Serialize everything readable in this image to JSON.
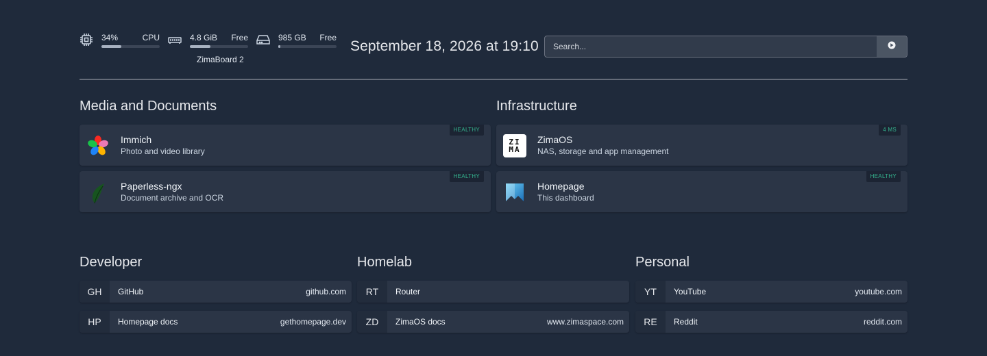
{
  "widgets": {
    "cpu": {
      "value": "34%",
      "label": "CPU",
      "percent": 34
    },
    "memory": {
      "value": "4.8 GiB",
      "label": "Free",
      "percent": 35
    },
    "disk": {
      "value": "985 GB",
      "label": "Free",
      "percent": 3
    },
    "host": "ZimaBoard 2",
    "datetime": "September 18, 2026 at 19:10",
    "search": {
      "placeholder": "Search..."
    }
  },
  "services": [
    {
      "title": "Media and Documents",
      "items": [
        {
          "name": "Immich",
          "description": "Photo and video library",
          "status": "HEALTHY",
          "icon": "immich-icon"
        },
        {
          "name": "Paperless-ngx",
          "description": "Document archive and OCR",
          "status": "HEALTHY",
          "icon": "paperless-icon"
        }
      ]
    },
    {
      "title": "Infrastructure",
      "items": [
        {
          "name": "ZimaOS",
          "description": "NAS, storage and app management",
          "status": "4 MS",
          "icon": "zimaos-icon",
          "logo_text": "ZIMA"
        },
        {
          "name": "Homepage",
          "description": "This dashboard",
          "status": "HEALTHY",
          "icon": "homepage-icon"
        }
      ]
    }
  ],
  "bookmarks": [
    {
      "title": "Developer",
      "items": [
        {
          "abbr": "GH",
          "name": "GitHub",
          "href": "github.com"
        },
        {
          "abbr": "HP",
          "name": "Homepage docs",
          "href": "gethomepage.dev"
        }
      ]
    },
    {
      "title": "Homelab",
      "items": [
        {
          "abbr": "RT",
          "name": "Router",
          "href": ""
        },
        {
          "abbr": "ZD",
          "name": "ZimaOS docs",
          "href": "www.zimaspace.com"
        }
      ]
    },
    {
      "title": "Personal",
      "items": [
        {
          "abbr": "YT",
          "name": "YouTube",
          "href": "youtube.com"
        },
        {
          "abbr": "RE",
          "name": "Reddit",
          "href": "reddit.com"
        }
      ]
    }
  ],
  "colors": {
    "background": "#1f2a3b",
    "card": "#2b3546",
    "status_text": "#34b58f",
    "bar_fill": "#a8b2c1"
  }
}
